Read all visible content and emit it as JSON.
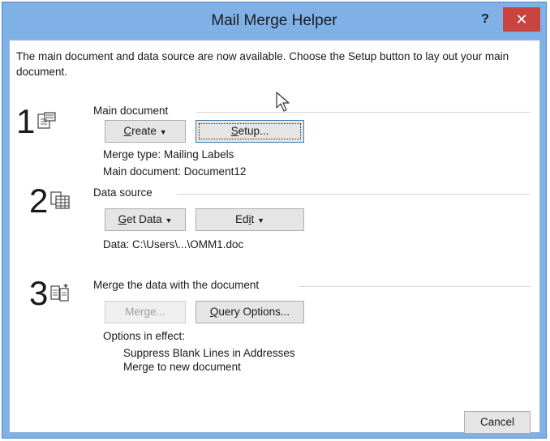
{
  "window": {
    "title": "Mail Merge Helper",
    "help_label": "?",
    "close_label": "✕"
  },
  "intro": "The main document and data source are now available. Choose the Setup button to lay out your main document.",
  "step1": {
    "number": "1",
    "title": "Main document",
    "create_label": "Create",
    "create_accel": "C",
    "create_rest": "reate",
    "setup_accel": "S",
    "setup_rest": "etup...",
    "merge_type": "Merge type:  Mailing Labels",
    "main_document": "Main document:  Document12"
  },
  "step2": {
    "number": "2",
    "title": "Data source",
    "getdata_accel": "G",
    "getdata_rest": "et Data",
    "edit_pre": "Ed",
    "edit_accel": "i",
    "edit_post": "t",
    "data_text": "Data:  C:\\Users\\...\\OMM1.doc"
  },
  "step3": {
    "number": "3",
    "title": "Merge the data with the document",
    "merge_label": "Merge...",
    "query_accel": "Q",
    "query_rest": "uery Options...",
    "options_label": "Options in effect:",
    "options": [
      "Suppress Blank Lines in Addresses",
      "Merge to new document"
    ]
  },
  "footer": {
    "cancel_label": "Cancel"
  },
  "colors": {
    "titlebar": "#7fb1e7",
    "close": "#c9433f",
    "button_face": "#e5e5e5"
  },
  "icons": {
    "step1": "main-document-icon",
    "step2": "data-source-icon",
    "step3": "merge-icon",
    "dropdown": "dropdown-arrow-icon",
    "cursor": "mouse-pointer-icon"
  }
}
